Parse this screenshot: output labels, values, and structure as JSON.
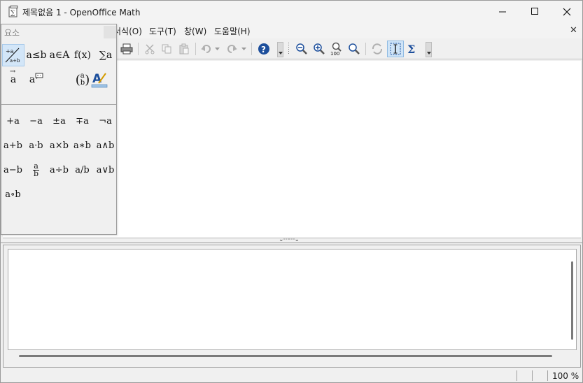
{
  "window": {
    "title": "제목없음 1 - OpenOffice Math"
  },
  "menu": {
    "items": [
      "서식(O)",
      "도구(T)",
      "창(W)",
      "도움말(H)"
    ]
  },
  "toolbar": {
    "icons": [
      "print-icon",
      "cut-icon",
      "copy-icon",
      "paste-icon",
      "undo-icon",
      "redo-icon",
      "help-icon",
      "zoom-out-icon",
      "zoom-in-icon",
      "zoom-100-icon",
      "show-all-icon",
      "update-icon",
      "formula-cursor-icon",
      "symbols-icon"
    ],
    "zoom_100_label": "100"
  },
  "elements_panel": {
    "title": "요소",
    "categories": [
      {
        "label": "unary-binary-operators",
        "selected": true
      },
      {
        "label": "a≤b"
      },
      {
        "label": "a∈A"
      },
      {
        "label": "f(x)"
      },
      {
        "label": "∑a"
      },
      {
        "label": "a⃗"
      },
      {
        "label": "attributes"
      },
      {
        "label": "brackets"
      },
      {
        "label": "formats"
      }
    ],
    "category_text": {
      "relations": "a≤b",
      "sets": "a∈A",
      "functions": "f(x)",
      "operators": "∑a",
      "attributes": "a",
      "brackets_top": "a",
      "brackets_bottom": "b",
      "vector": "a"
    },
    "operators": [
      "+a",
      "−a",
      "±a",
      "∓a",
      "¬a",
      "a+b",
      "a·b",
      "a×b",
      "a∗b",
      "a∧b",
      "a−b",
      "a/b fraction",
      "a÷b",
      "a/b",
      "a∨b",
      "a∘b"
    ],
    "operator_text": {
      "pos": "+a",
      "neg": "−a",
      "plusminus": "±a",
      "minusplus": "∓a",
      "not": "¬a",
      "plus": "a+b",
      "cdot": "a·b",
      "times": "a×b",
      "ast": "a∗b",
      "and": "a∧b",
      "minus": "a−b",
      "frac_num": "a",
      "frac_den": "b",
      "div": "a÷b",
      "slash": "a/b",
      "or": "a∨b",
      "circ": "a∘b"
    }
  },
  "formula": {
    "commands": ""
  },
  "status": {
    "zoom": "100 %"
  }
}
